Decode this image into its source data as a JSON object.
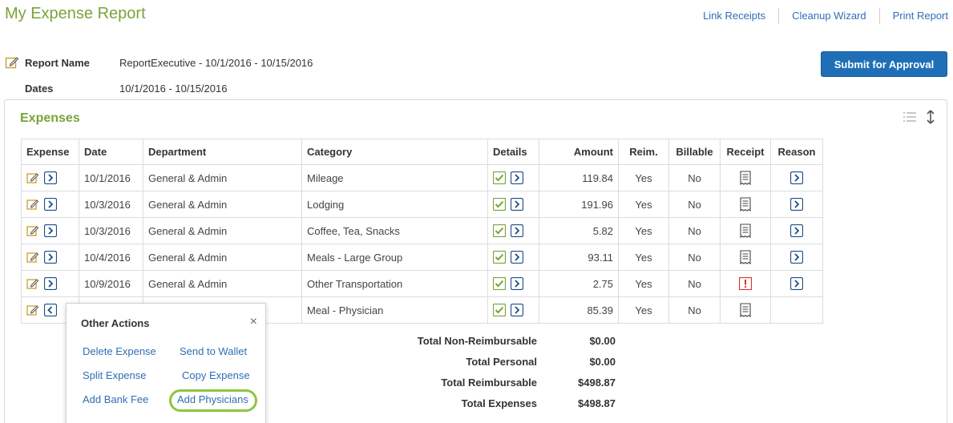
{
  "header": {
    "title": "My Expense Report",
    "links": [
      "Link Receipts",
      "Cleanup Wizard",
      "Print Report"
    ]
  },
  "report": {
    "name_label": "Report Name",
    "name_value": "ReportExecutive - 10/1/2016 - 10/15/2016",
    "dates_label": "Dates",
    "dates_value": "10/1/2016 - 10/15/2016"
  },
  "submit_label": "Submit for Approval",
  "expenses": {
    "title": "Expenses",
    "columns": [
      "Expense",
      "Date",
      "Department",
      "Category",
      "Details",
      "Amount",
      "Reim.",
      "Billable",
      "Receipt",
      "Reason"
    ],
    "rows": [
      {
        "date": "10/1/2016",
        "department": "General & Admin",
        "category": "Mileage",
        "amount": "119.84",
        "reim": "Yes",
        "billable": "No",
        "receipt": "receipt",
        "reason": true
      },
      {
        "date": "10/3/2016",
        "department": "General & Admin",
        "category": "Lodging",
        "amount": "191.96",
        "reim": "Yes",
        "billable": "No",
        "receipt": "receipt",
        "reason": true
      },
      {
        "date": "10/3/2016",
        "department": "General & Admin",
        "category": "Coffee, Tea, Snacks",
        "amount": "5.82",
        "reim": "Yes",
        "billable": "No",
        "receipt": "receipt",
        "reason": true
      },
      {
        "date": "10/4/2016",
        "department": "General & Admin",
        "category": "Meals - Large Group",
        "amount": "93.11",
        "reim": "Yes",
        "billable": "No",
        "receipt": "receipt",
        "reason": true
      },
      {
        "date": "10/9/2016",
        "department": "General & Admin",
        "category": "Other Transportation",
        "amount": "2.75",
        "reim": "Yes",
        "billable": "No",
        "receipt": "missing",
        "reason": true
      },
      {
        "date": "",
        "department": "",
        "category": "Meal - Physician",
        "amount": "85.39",
        "reim": "Yes",
        "billable": "No",
        "receipt": "receipt",
        "reason": false
      }
    ]
  },
  "totals": [
    {
      "label": "Total Non-Reimbursable",
      "value": "$0.00"
    },
    {
      "label": "Total Personal",
      "value": "$0.00"
    },
    {
      "label": "Total Reimbursable",
      "value": "$498.87"
    },
    {
      "label": "Total Expenses",
      "value": "$498.87"
    }
  ],
  "popup": {
    "title": "Other Actions",
    "close": "×",
    "actions": [
      "Delete Expense",
      "Send to Wallet",
      "Split Expense",
      "Copy Expense",
      "Add Bank Fee",
      "Add Physicians"
    ]
  },
  "colors": {
    "accent_green": "#7aa33a",
    "link_blue": "#2f6fb5",
    "button_blue": "#1f6fb8",
    "highlight": "#8cc63f",
    "alert_red": "#d9342b"
  }
}
